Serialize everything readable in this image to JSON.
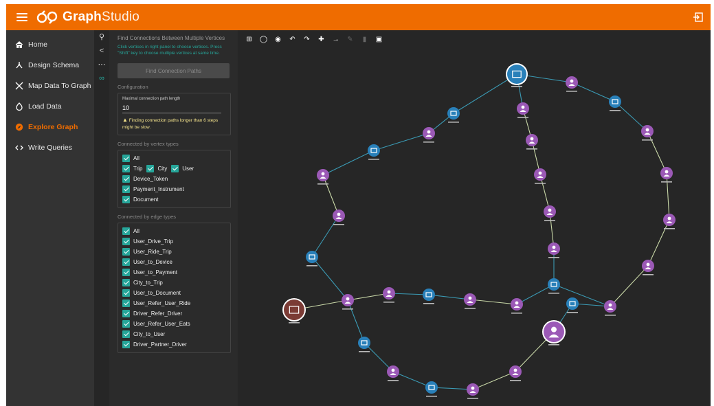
{
  "app": {
    "title_bold": "Graph",
    "title_light": "Studio"
  },
  "sidebar": {
    "items": [
      {
        "label": "Home",
        "icon": "home-icon"
      },
      {
        "label": "Design Schema",
        "icon": "schema-icon"
      },
      {
        "label": "Map Data To Graph",
        "icon": "shuffle-icon"
      },
      {
        "label": "Load Data",
        "icon": "load-icon"
      },
      {
        "label": "Explore Graph",
        "icon": "explore-icon",
        "active": true
      },
      {
        "label": "Write Queries",
        "icon": "code-icon"
      }
    ]
  },
  "panel": {
    "title": "Find Connections Between Multiple Vertices",
    "hint": "Click vertices in right panel to choose vertices. Press \"Shift\" key to choose multiple vertices at same time.",
    "find_button": "Find Connection Paths",
    "config_title": "Configuration",
    "max_len_label": "Maximal connection path length",
    "max_len_value": "10",
    "warning": "Finding connection paths longer than 6 steps might be slow.",
    "vertex_types_title": "Connected by vertex types",
    "vertex_types": {
      "all": "All",
      "trip": "Trip",
      "city": "City",
      "user": "User",
      "device_token": "Device_Token",
      "payment_instrument": "Payment_Instrument",
      "document": "Document"
    },
    "edge_types_title": "Connected by edge types",
    "edge_types": [
      "All",
      "User_Drive_Trip",
      "User_Ride_Trip",
      "User_to_Device",
      "User_to_Payment",
      "City_to_Trip",
      "User_to_Document",
      "User_Refer_User_Ride",
      "Driver_Refer_Driver",
      "User_Refer_User_Eats",
      "City_to_User",
      "Driver_Partner_Driver"
    ]
  },
  "colors": {
    "brand": "#ef6c00",
    "accent": "#26a69a",
    "node_user": "#9b59b6",
    "node_trip": "#2980b9",
    "node_city": "#7b3b35",
    "edge_default": "#c9d8a8"
  }
}
